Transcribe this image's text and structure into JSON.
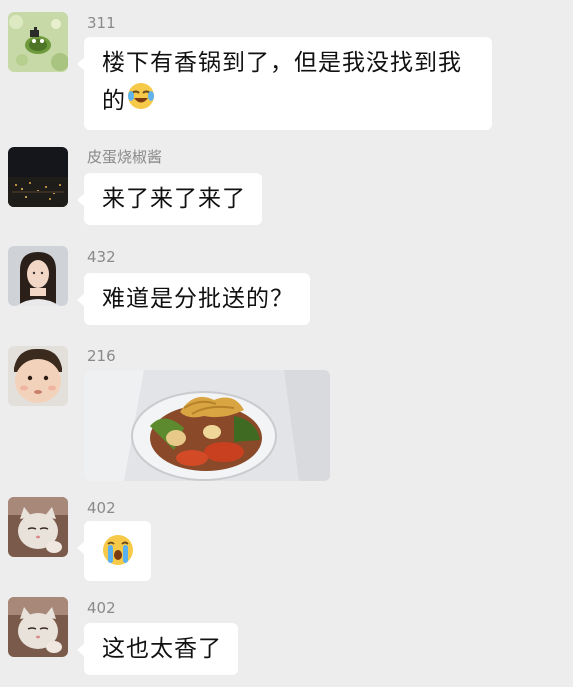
{
  "messages": [
    {
      "sender": "311",
      "avatar": "frog-avatar",
      "text_line1": "楼下有香锅到了，但是我没找到我",
      "text_line2": "的",
      "emoji": "laughing-crying-emoji"
    },
    {
      "sender": "皮蛋烧椒酱",
      "avatar": "night-city-avatar",
      "text": "来了来了来了"
    },
    {
      "sender": "432",
      "avatar": "girl-avatar",
      "text": "难道是分批送的？"
    },
    {
      "sender": "216",
      "avatar": "child-avatar",
      "image": "food-bowl-photo"
    },
    {
      "sender": "402",
      "avatar": "cat-avatar",
      "emoji": "crying-face-emoji"
    },
    {
      "sender": "402",
      "avatar": "cat-avatar",
      "text": "这也太香了"
    }
  ],
  "colors": {
    "background": "#ededed",
    "bubble": "#ffffff",
    "sender": "#8a8a8a"
  }
}
